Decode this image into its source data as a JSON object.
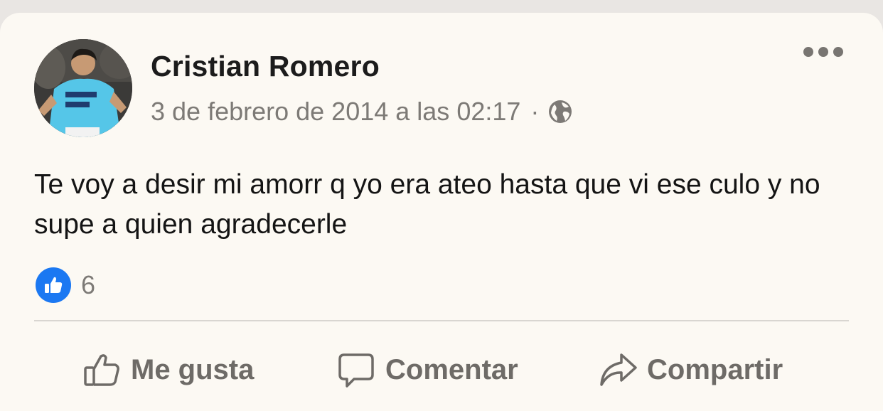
{
  "post": {
    "author": "Cristian Romero",
    "timestamp": "3 de febrero de 2014 a las 02:17",
    "separator": "·",
    "audience_icon": "globe-icon",
    "text": "Te voy a desir mi amorr q yo era ateo hasta que vi ese culo y no supe a quien agradecerle",
    "reaction_icon": "like-icon",
    "reaction_count": "6"
  },
  "actions": {
    "like_label": "Me gusta",
    "comment_label": "Comentar",
    "share_label": "Compartir"
  },
  "colors": {
    "card_background": "#fcf9f3",
    "like_blue": "#1b78f2",
    "muted_text": "#7d7a76"
  }
}
